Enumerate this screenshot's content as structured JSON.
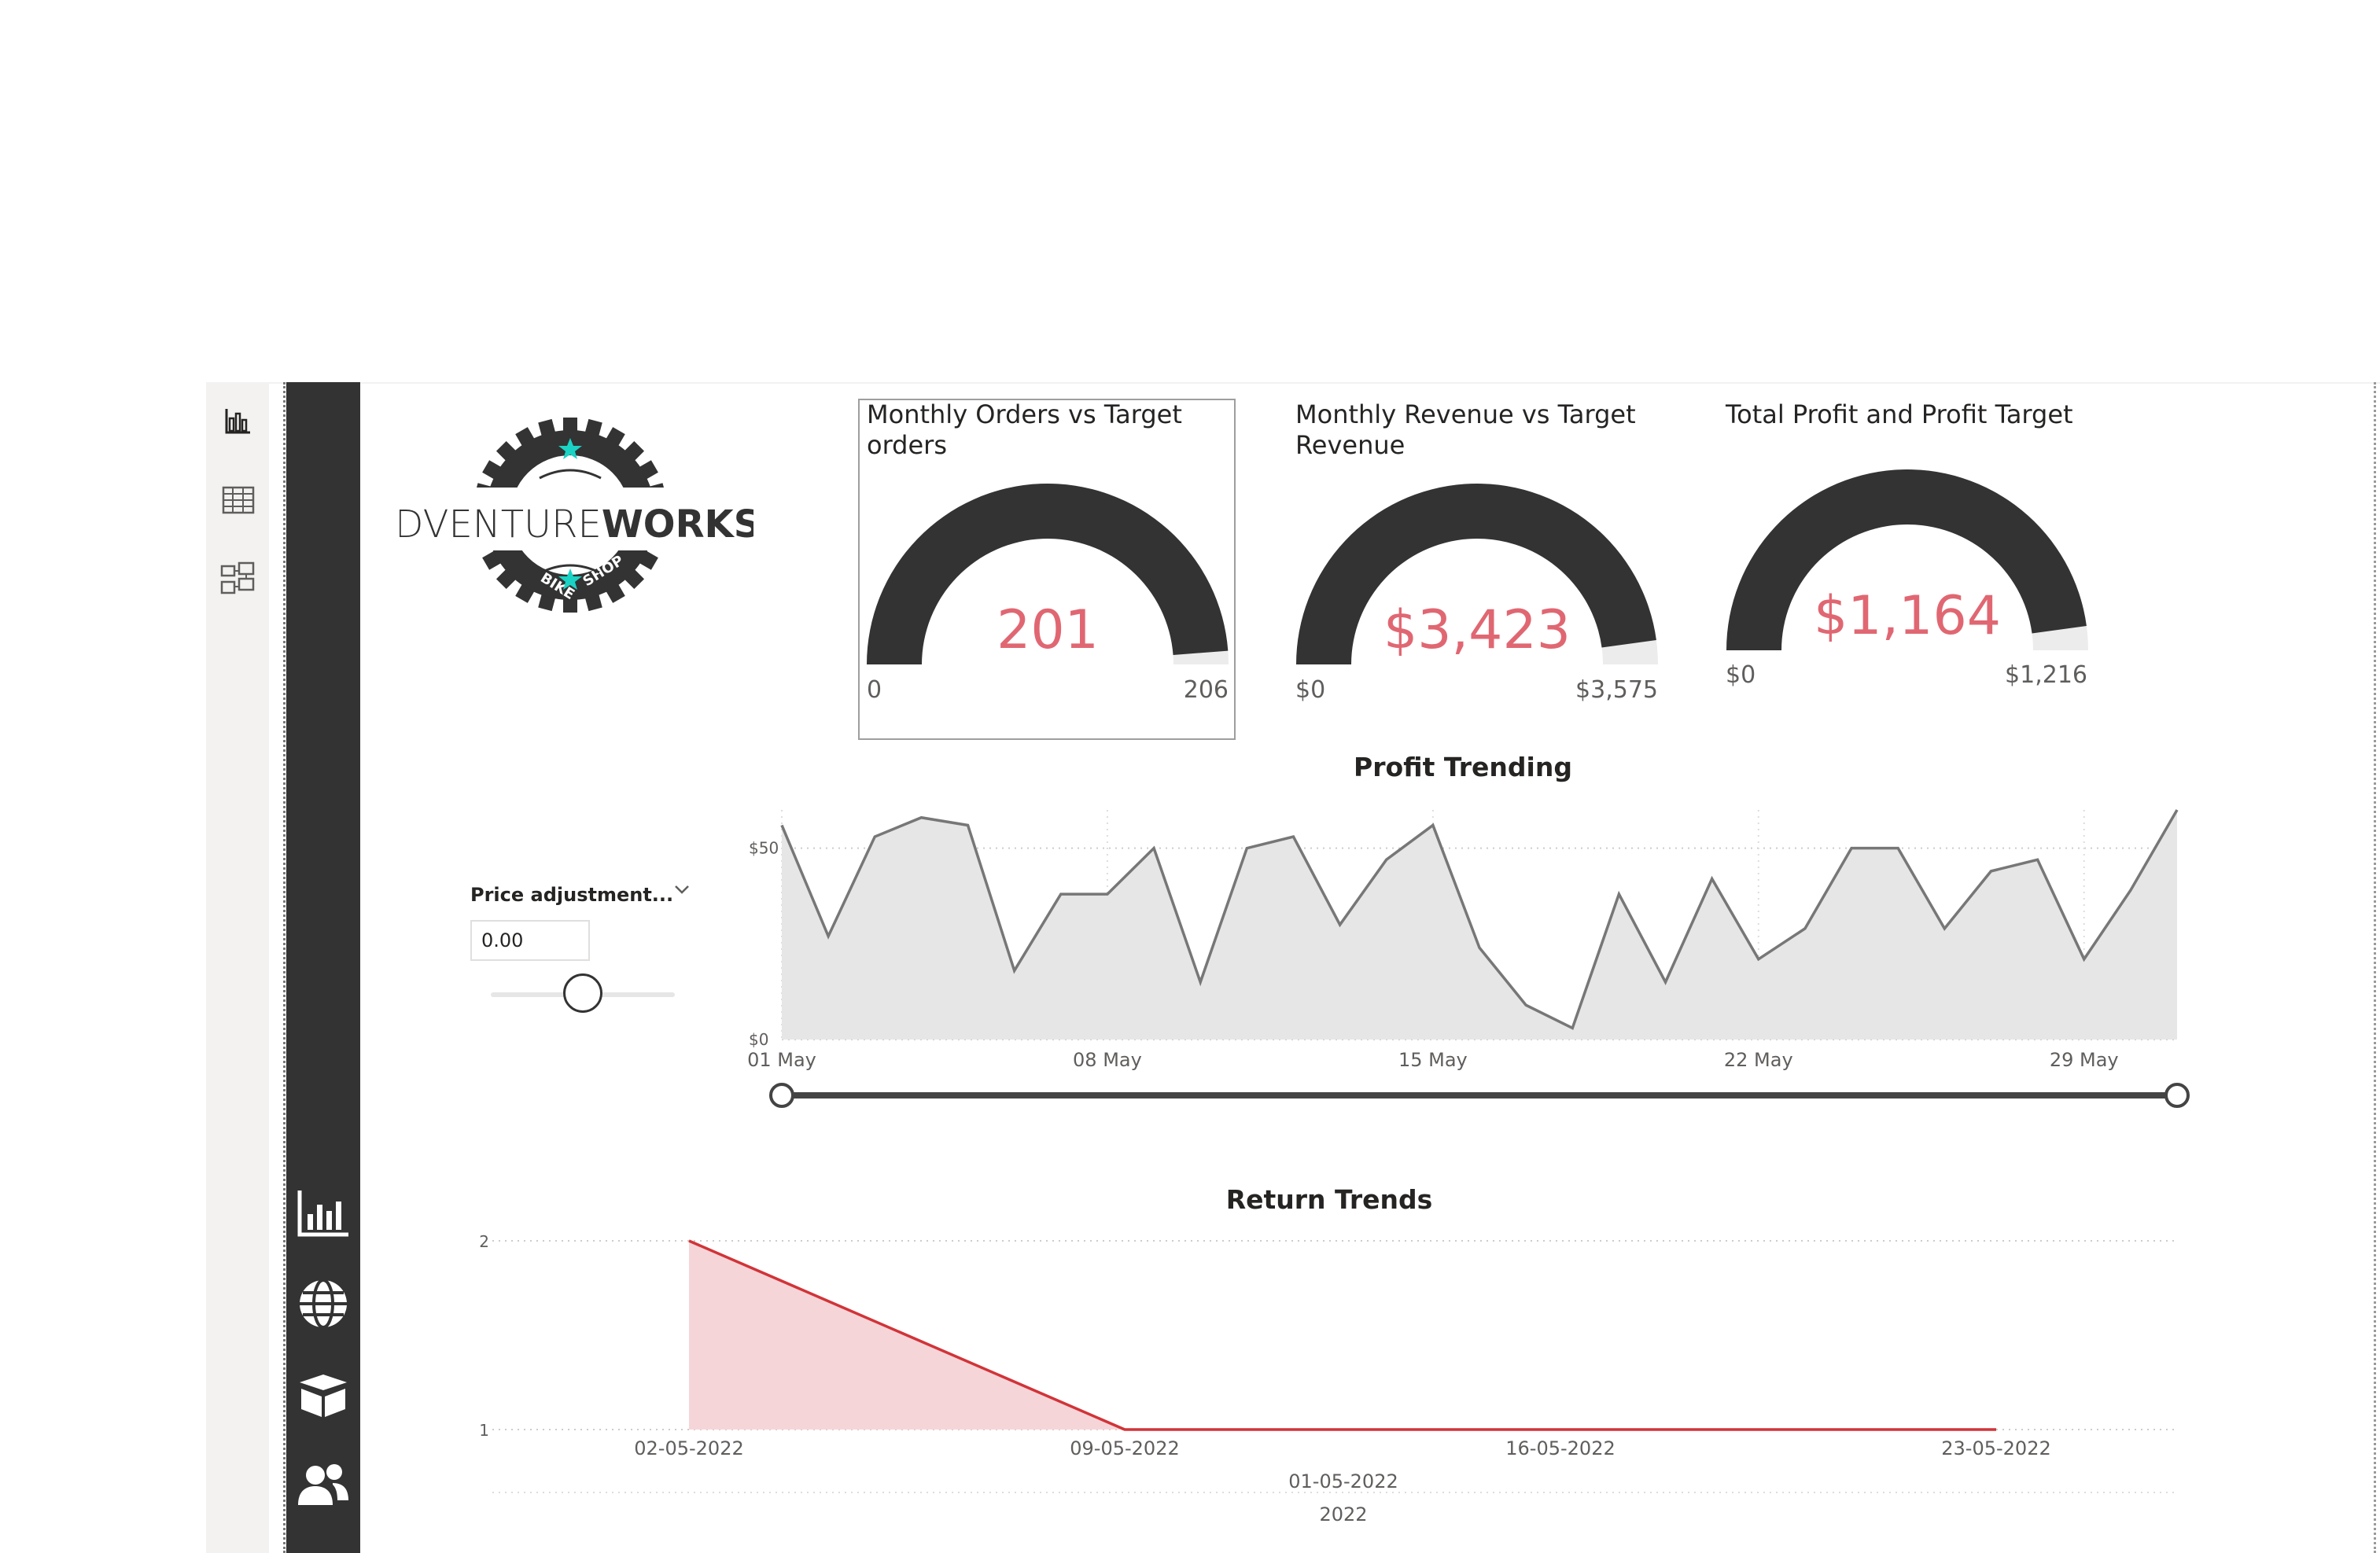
{
  "nav": {
    "rail": [
      {
        "icon": "report-view-icon"
      },
      {
        "icon": "table-view-icon"
      },
      {
        "icon": "model-view-icon"
      }
    ],
    "pages": [
      {
        "icon": "bar-chart-icon"
      },
      {
        "icon": "globe-icon"
      },
      {
        "icon": "box-icon"
      },
      {
        "icon": "users-icon"
      }
    ]
  },
  "logo": {
    "word_light": "ADVENTURE",
    "word_bold": "WORKS",
    "sub_left": "BIKE",
    "sub_right": "SHOP",
    "accent": "#1ad3c5"
  },
  "gauges": [
    {
      "title": "Monthly Orders vs Target\norders",
      "value": "201",
      "min": "0",
      "max": "206",
      "fill_fraction": 0.976
    },
    {
      "title": "Monthly Revenue vs Target\nRevenue",
      "value": "$3,423",
      "min": "$0",
      "max": "$3,575",
      "fill_fraction": 0.957
    },
    {
      "title": "Total Profit and Profit Target",
      "value": "$1,164",
      "min": "$0",
      "max": "$1,216",
      "fill_fraction": 0.957
    }
  ],
  "slicer": {
    "label": "Price adjustment...",
    "value": "0.00",
    "slider_fraction": 0.5
  },
  "colors": {
    "gauge_fill": "#333333",
    "gauge_track": "#ececec",
    "value": "#e06772",
    "return_line": "#d13438",
    "return_fill": "#f6d5d9",
    "profit_line": "#777777",
    "profit_fill": "#e6e6e6"
  },
  "chart_data": [
    {
      "type": "area",
      "title": "Profit Trending",
      "x": [
        "01 May",
        "02 May",
        "03 May",
        "04 May",
        "05 May",
        "06 May",
        "07 May",
        "08 May",
        "09 May",
        "10 May",
        "11 May",
        "12 May",
        "13 May",
        "14 May",
        "15 May",
        "16 May",
        "17 May",
        "18 May",
        "19 May",
        "20 May",
        "21 May",
        "22 May",
        "23 May",
        "24 May",
        "25 May",
        "26 May",
        "27 May",
        "28 May",
        "29 May",
        "30 May",
        "31 May"
      ],
      "x_tick_labels": [
        "01 May",
        "08 May",
        "15 May",
        "22 May",
        "29 May"
      ],
      "y_tick_labels": [
        "$0",
        "$50"
      ],
      "values": [
        56,
        27,
        53,
        58,
        56,
        18,
        38,
        38,
        50,
        15,
        50,
        53,
        30,
        47,
        56,
        24,
        9,
        3,
        38,
        15,
        42,
        21,
        29,
        50,
        50,
        29,
        44,
        47,
        21,
        39,
        60
      ],
      "ylim": [
        0,
        60
      ]
    },
    {
      "type": "area",
      "title": "Return Trends",
      "x": [
        "02-05-2022",
        "09-05-2022",
        "16-05-2022",
        "23-05-2022"
      ],
      "x_tick_labels": [
        "02-05-2022",
        "09-05-2022",
        "16-05-2022",
        "23-05-2022"
      ],
      "x_group_labels": [
        "01-05-2022",
        "2022"
      ],
      "y_tick_labels": [
        "1",
        "2"
      ],
      "values": [
        2,
        1,
        1,
        1
      ],
      "ylim": [
        1,
        2
      ]
    }
  ]
}
